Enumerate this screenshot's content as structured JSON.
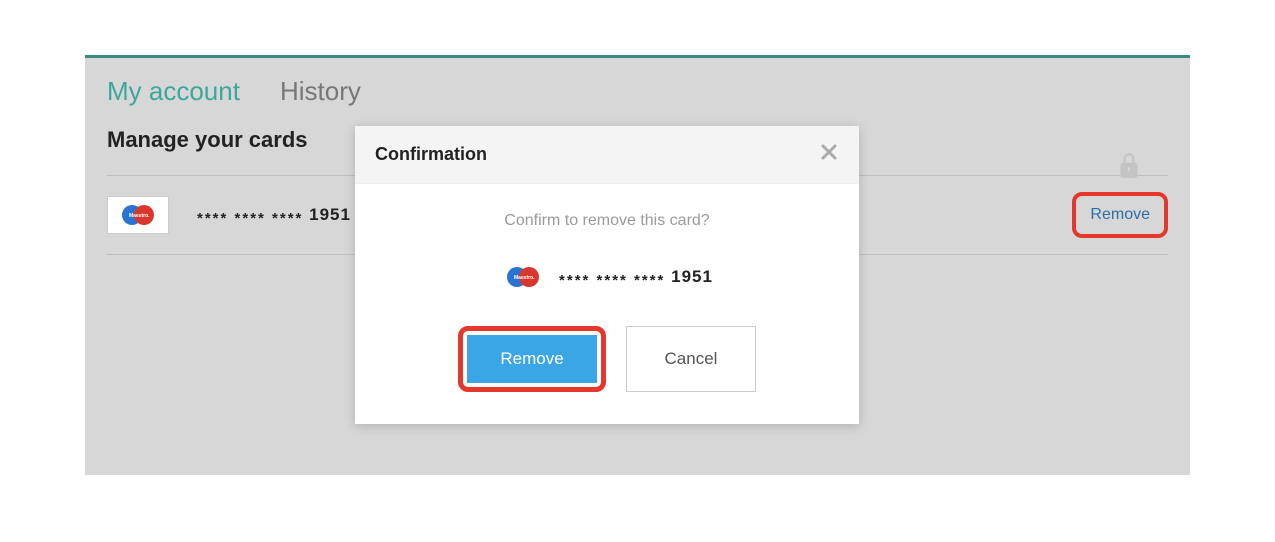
{
  "tabs": {
    "my_account": "My account",
    "history": "History"
  },
  "page_title": "Manage your cards",
  "card": {
    "brand": "Maestro",
    "mask": "**** **** ****",
    "last4": "1951",
    "remove_label": "Remove"
  },
  "modal": {
    "title": "Confirmation",
    "message": "Confirm to remove this card?",
    "card_mask": "**** **** ****",
    "card_last4": "1951",
    "remove_button": "Remove",
    "cancel_button": "Cancel"
  },
  "icons": {
    "lock": "lock-icon",
    "close": "close-icon"
  },
  "colors": {
    "accent": "#3aa99a",
    "primary_button": "#3aa6e6",
    "highlight": "#e4382c",
    "link": "#2b6ea8"
  }
}
